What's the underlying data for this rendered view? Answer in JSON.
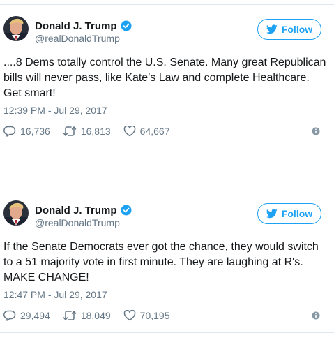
{
  "colors": {
    "accent": "#1da1f2",
    "secondary_text": "#657786",
    "border": "#e1e8ed"
  },
  "tweets": [
    {
      "display_name": "Donald J. Trump",
      "handle": "@realDonaldTrump",
      "follow_label": "Follow",
      "text": "....8 Dems totally control the U.S. Senate. Many great Republican bills will never pass, like Kate's Law and complete Healthcare. Get smart!",
      "timestamp": "12:39 PM - Jul 29, 2017",
      "replies": "16,736",
      "retweets": "16,813",
      "likes": "64,667",
      "icons": [
        "avatar",
        "verified-badge-icon",
        "twitter-bird-icon",
        "reply-icon",
        "retweet-icon",
        "like-icon",
        "info-icon"
      ]
    },
    {
      "display_name": "Donald J. Trump",
      "handle": "@realDonaldTrump",
      "follow_label": "Follow",
      "text": "If the Senate Democrats ever got the chance, they would switch to a 51 majority vote in first minute. They are laughing at R's. MAKE CHANGE!",
      "timestamp": "12:47 PM - Jul 29, 2017",
      "replies": "29,494",
      "retweets": "18,049",
      "likes": "70,195",
      "icons": [
        "avatar",
        "verified-badge-icon",
        "twitter-bird-icon",
        "reply-icon",
        "retweet-icon",
        "like-icon",
        "info-icon"
      ]
    }
  ]
}
